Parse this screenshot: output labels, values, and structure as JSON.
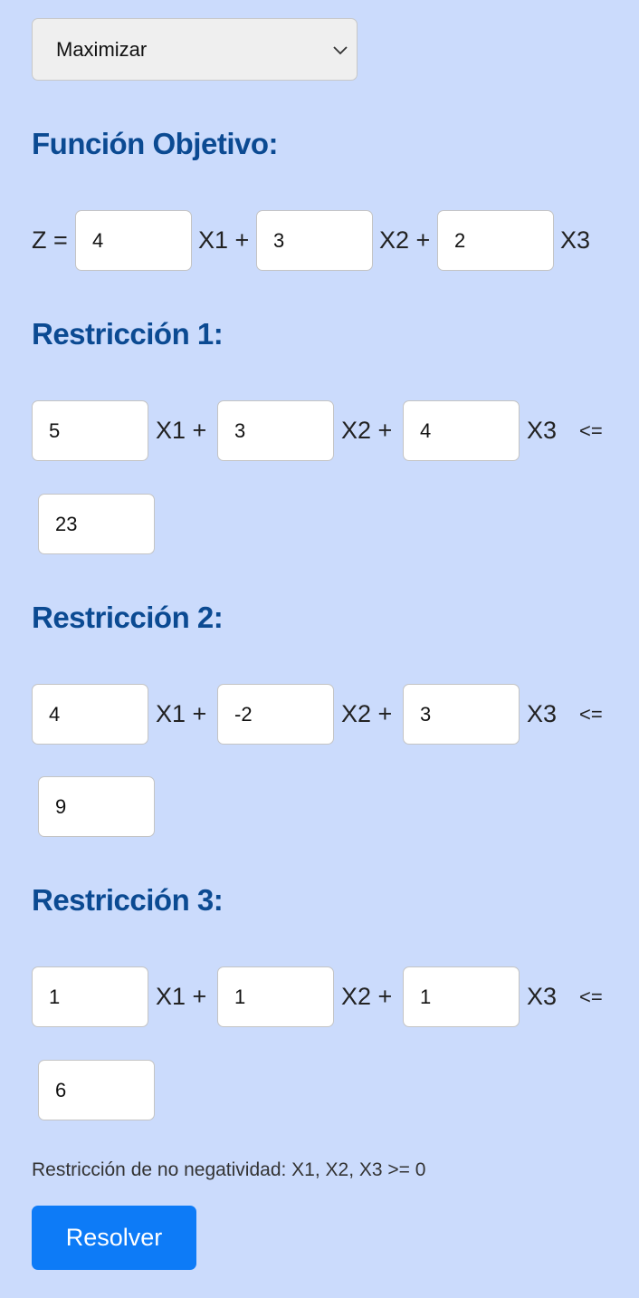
{
  "select": {
    "value": "Maximizar"
  },
  "objective": {
    "heading": "Función Objetivo:",
    "z_label": "Z =",
    "coefs": [
      "4",
      "3",
      "2"
    ],
    "terms": [
      "X1 +",
      "X2 +",
      "X3"
    ]
  },
  "restrictions": [
    {
      "heading": "Restricción 1:",
      "coefs": [
        "5",
        "3",
        "4"
      ],
      "terms": [
        "X1 +",
        "X2 +",
        "X3"
      ],
      "op": "<=",
      "rhs": "23"
    },
    {
      "heading": "Restricción 2:",
      "coefs": [
        "4",
        "-2",
        "3"
      ],
      "terms": [
        "X1 +",
        "X2 +",
        "X3"
      ],
      "op": "<=",
      "rhs": "9"
    },
    {
      "heading": "Restricción 3:",
      "coefs": [
        "1",
        "1",
        "1"
      ],
      "terms": [
        "X1 +",
        "X2 +",
        "X3"
      ],
      "op": "<=",
      "rhs": "6"
    }
  ],
  "nonneg": "Restricción de no negatividad: X1, X2, X3 >= 0",
  "button": {
    "label": "Resolver"
  },
  "colors": {
    "background": "#cbdbfc",
    "heading": "#0b4a92",
    "button": "#0d7bf7"
  }
}
